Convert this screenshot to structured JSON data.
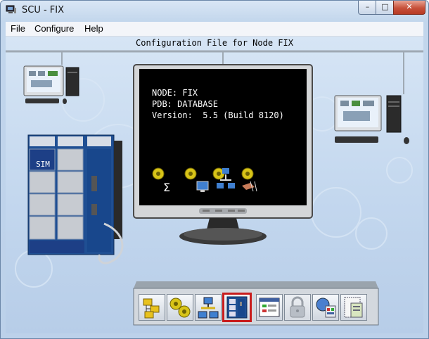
{
  "window": {
    "title": "SCU - FIX",
    "controls": {
      "minimize": "–",
      "maximize": "□",
      "close": "✕"
    }
  },
  "menu": {
    "items": [
      "File",
      "Configure",
      "Help"
    ]
  },
  "main": {
    "config_title": "Configuration File for Node FIX",
    "monitor": {
      "node_line": "NODE: FIX",
      "pdb_line": "PDB: DATABASE",
      "version_line": "Version:  5.5 (Build 8120)",
      "icons": [
        "alarm-summary-icon",
        "alarm-display-icon",
        "alarm-network-icon",
        "alarm-operator-icon"
      ]
    },
    "controller": {
      "slot_label": "SIM"
    }
  },
  "toolbar": {
    "buttons": [
      {
        "name": "system-tree-icon",
        "state": "normal"
      },
      {
        "name": "alarm-config-icon",
        "state": "normal"
      },
      {
        "name": "network-config-icon",
        "state": "normal"
      },
      {
        "name": "scada-config-icon",
        "state": "selected"
      },
      {
        "name": "task-config-icon",
        "state": "normal"
      },
      {
        "name": "security-icon",
        "state": "disabled"
      },
      {
        "name": "sql-config-icon",
        "state": "normal"
      },
      {
        "name": "local-startup-icon",
        "state": "normal"
      }
    ],
    "selected_color": "#c81d1d"
  },
  "colors": {
    "background": "#c3d7ee",
    "screen": "#000000",
    "controller": "#1f4f93"
  }
}
